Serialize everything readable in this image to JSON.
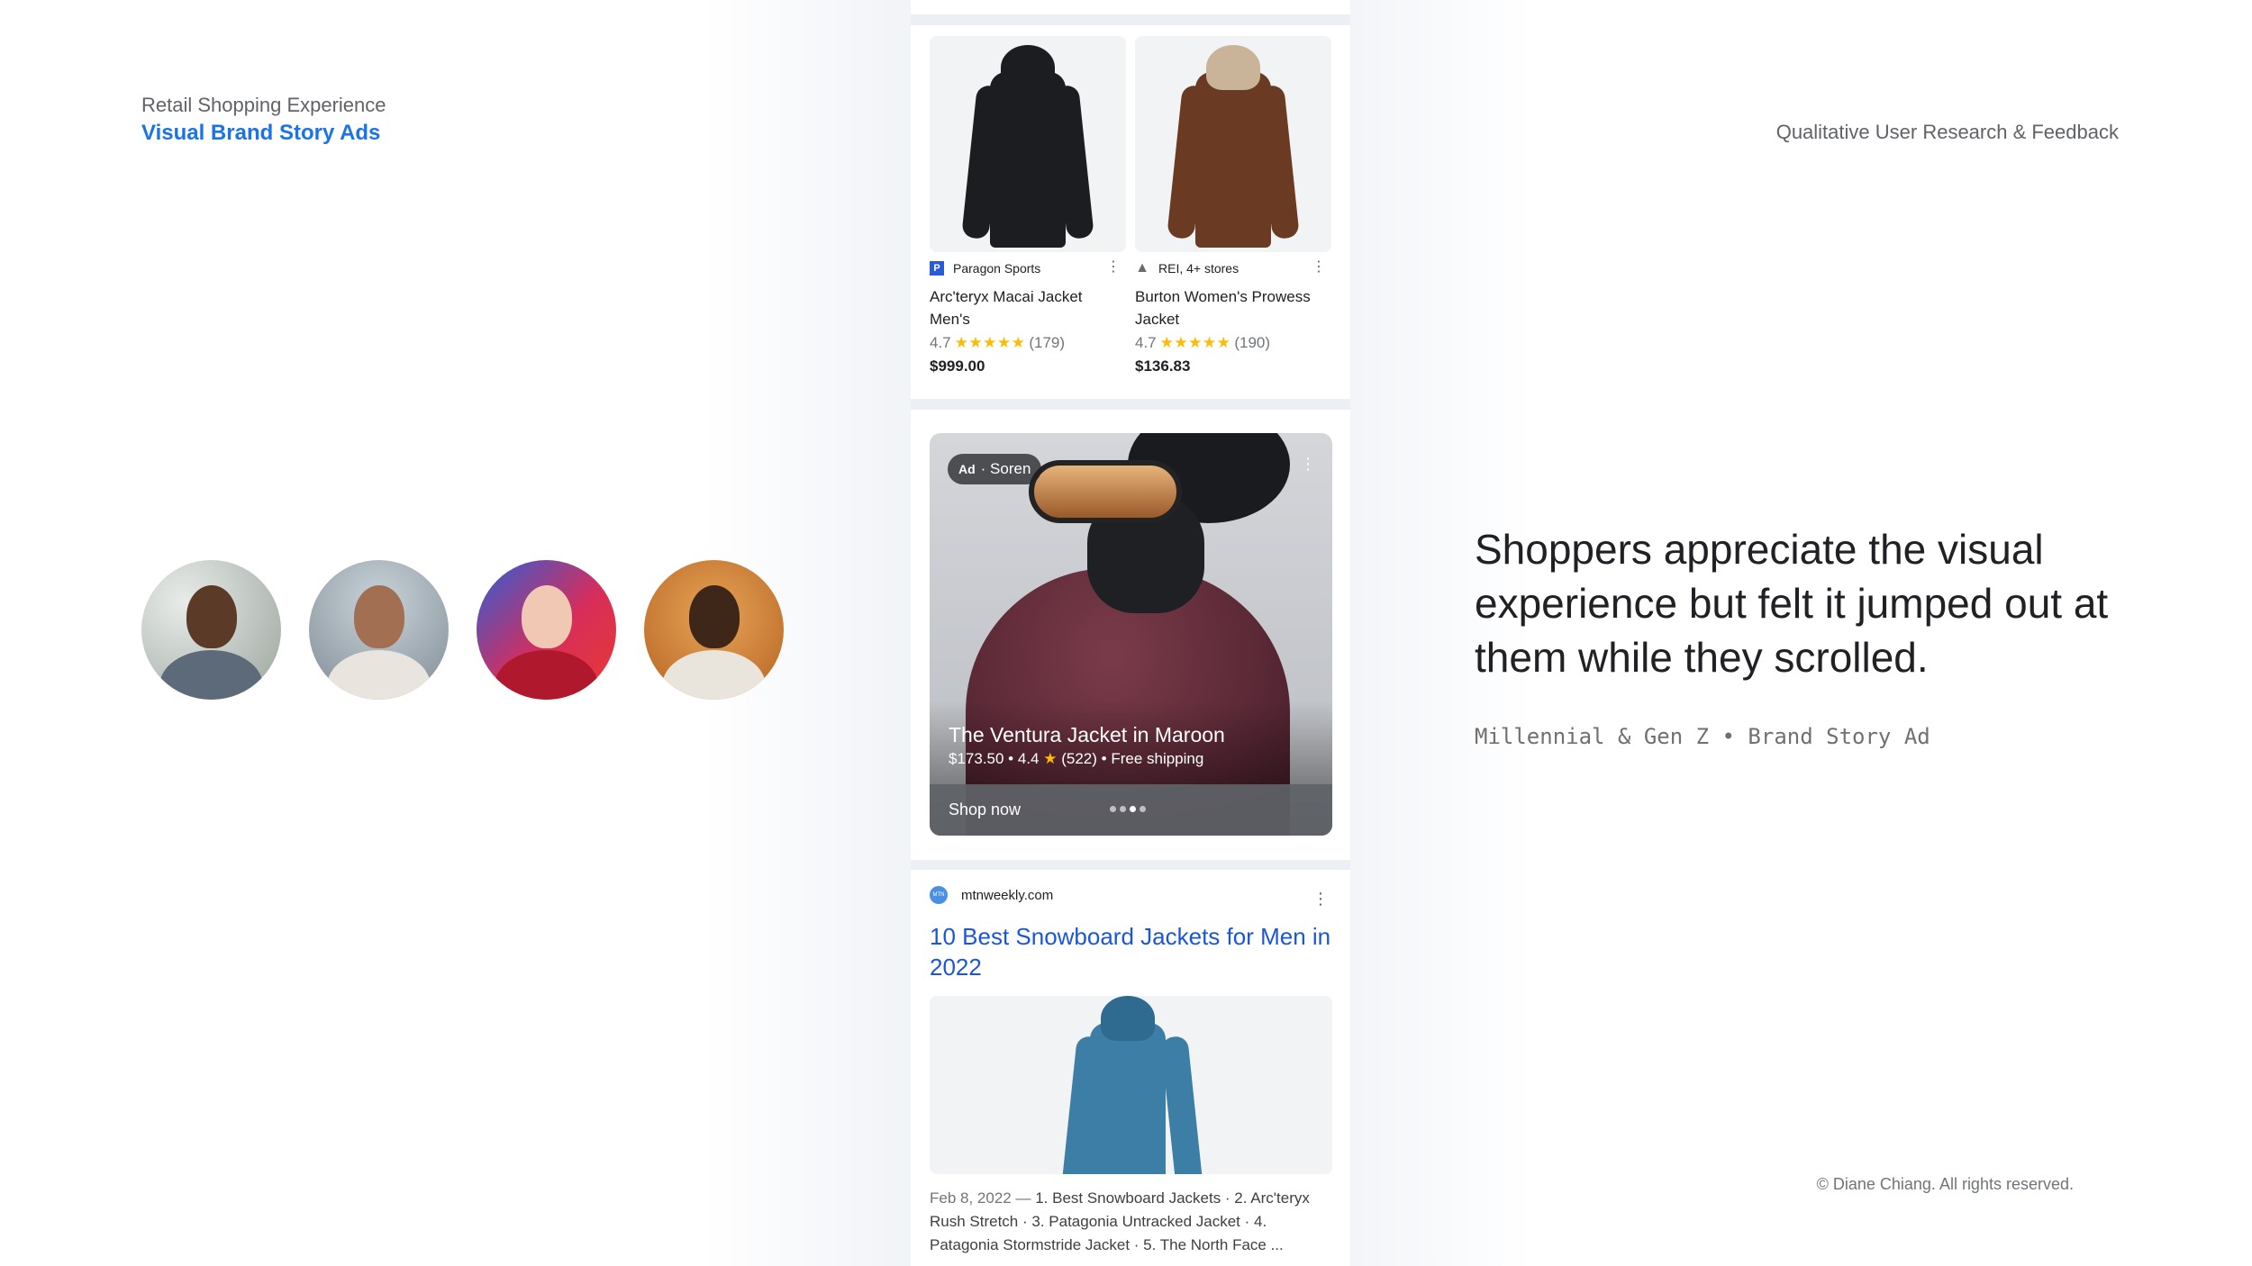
{
  "header": {
    "kicker": "Retail Shopping Experience",
    "title": "Visual Brand Story Ads",
    "research": "Qualitative User Research & Feedback"
  },
  "insight": {
    "headline": "Shoppers appreciate the visual experience but felt it jumped out at them while they scrolled.",
    "segment": "Millennial & Gen Z • Brand Story Ad"
  },
  "footer": {
    "copyright": "© Diane Chiang. All rights reserved."
  },
  "products": [
    {
      "merchant": "Paragon Sports",
      "merchant_icon": "P",
      "name": "Arc'teryx Macai Jacket Men's",
      "rating": "4.7",
      "stars": "★★★★★",
      "reviews": "(179)",
      "price": "$999.00"
    },
    {
      "merchant": "REI, 4+ stores",
      "merchant_icon": "tree-icon",
      "name": "Burton Women's Prowess Jacket",
      "rating": "4.7",
      "stars": "★★★★★",
      "reviews": "(190)",
      "price": "$136.83"
    }
  ],
  "ad": {
    "badge": "Ad",
    "advertiser": "· Soren",
    "title": "The Ventura Jacket in Maroon",
    "price": "$173.50 •",
    "rating": "4.4",
    "reviews": "(522) • Free shipping",
    "cta": "Shop now",
    "carousel_index": 3,
    "carousel_total": 4
  },
  "article": {
    "site": "mtnweekly.com",
    "site_logo_text": "MTN",
    "title": "10 Best Snowboard Jackets for Men in 2022",
    "date": "Feb 8, 2022 —",
    "snippet": "1. Best Snowboard Jackets · 2. Arc'teryx Rush Stretch · 3. Patagonia Untracked Jacket · 4. Patagonia Stormstride Jacket · 5. The North Face ..."
  },
  "colors": {
    "accent_blue": "#1a73e8",
    "link_blue": "#1a56db",
    "star_yellow": "#fbbc04"
  }
}
